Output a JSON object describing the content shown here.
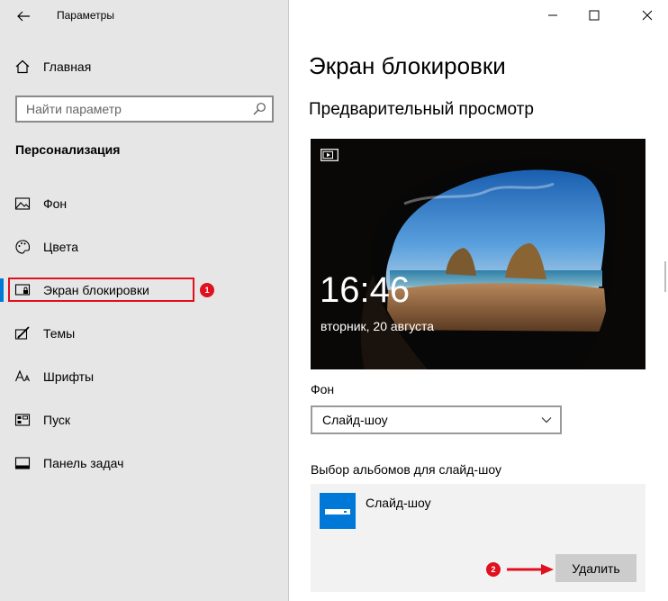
{
  "window": {
    "title": "Параметры",
    "controls": {
      "minimize_icon": "minimize-icon",
      "maximize_icon": "maximize-icon",
      "close_icon": "close-icon"
    }
  },
  "sidebar": {
    "back_icon": "back-arrow-icon",
    "home": {
      "label": "Главная",
      "icon": "home-icon"
    },
    "search": {
      "placeholder": "Найти параметр",
      "icon": "search-icon"
    },
    "section_title": "Персонализация",
    "items": [
      {
        "label": "Фон",
        "icon": "image-icon"
      },
      {
        "label": "Цвета",
        "icon": "palette-icon"
      },
      {
        "label": "Экран блокировки",
        "icon": "lock-screen-icon",
        "selected": true
      },
      {
        "label": "Темы",
        "icon": "brush-icon"
      },
      {
        "label": "Шрифты",
        "icon": "font-icon"
      },
      {
        "label": "Пуск",
        "icon": "start-icon"
      },
      {
        "label": "Панель задач",
        "icon": "taskbar-icon"
      }
    ],
    "annotation": "1"
  },
  "main": {
    "title": "Экран блокировки",
    "preview": {
      "heading": "Предварительный просмотр",
      "time": "16:46",
      "date": "вторник, 20 августа",
      "slideshow_icon": "slideshow-icon"
    },
    "background": {
      "label": "Фон",
      "selected": "Слайд-шоу"
    },
    "albums": {
      "label": "Выбор альбомов для слайд-шоу",
      "items": [
        {
          "name": "Слайд-шоу",
          "icon": "folder-icon"
        }
      ],
      "remove_label": "Удалить",
      "annotation": "2"
    }
  },
  "colors": {
    "accent": "#0078d7",
    "annotation_red": "#e0101e",
    "sidebar_bg": "#e6e6e6",
    "button_bg": "#cccccc"
  }
}
